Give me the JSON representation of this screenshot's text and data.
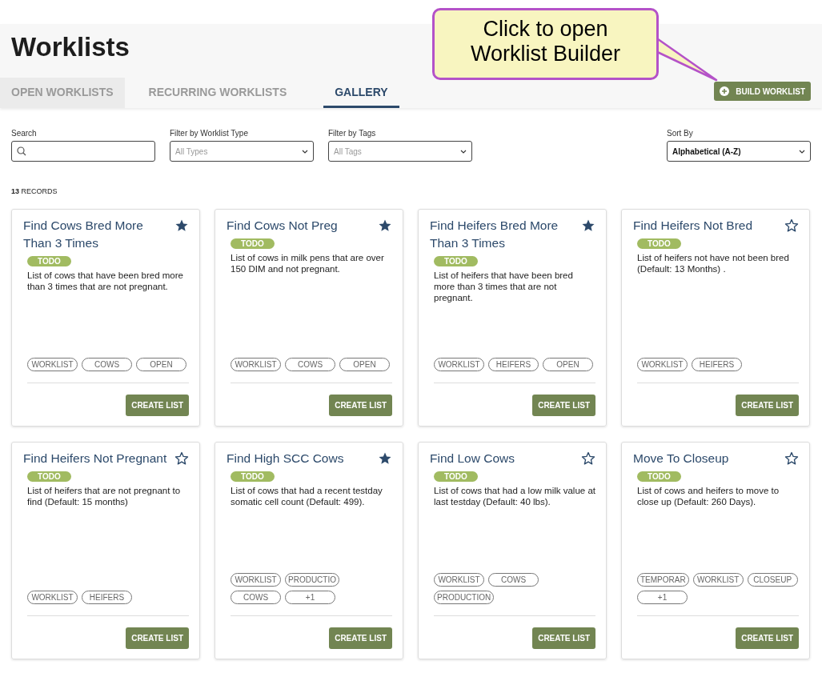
{
  "page": {
    "title": "Worklists"
  },
  "tabs": [
    {
      "label": "OPEN WORKLISTS",
      "selected": false,
      "hovered": true
    },
    {
      "label": "RECURRING WORKLISTS",
      "selected": false,
      "hovered": false
    },
    {
      "label": "GALLERY",
      "selected": true,
      "hovered": false
    }
  ],
  "build_button": {
    "label": "BUILD WORKLIST"
  },
  "callout": {
    "text": "Click to open Worklist Builder"
  },
  "filters": {
    "search": {
      "label": "Search"
    },
    "type": {
      "label": "Filter by Worklist Type",
      "value": "All Types"
    },
    "tags": {
      "label": "Filter by Tags",
      "value": "All Tags"
    },
    "sort": {
      "label": "Sort By",
      "value": "Alphabetical (A-Z)"
    }
  },
  "records": {
    "count": "13",
    "label": "RECORDS"
  },
  "cards": [
    {
      "title": "Find Cows Bred More Than 3 Times",
      "favorite": true,
      "status": "TODO",
      "description": "List of cows that have been bred more than 3 times that are not pregnant.",
      "tags": [
        "WORKLIST",
        "COWS",
        "OPEN"
      ],
      "button": "CREATE LIST"
    },
    {
      "title": "Find Cows Not Preg",
      "favorite": true,
      "status": "TODO",
      "description": "List of cows in milk pens that are over 150 DIM and not pregnant.",
      "tags": [
        "WORKLIST",
        "COWS",
        "OPEN"
      ],
      "button": "CREATE LIST"
    },
    {
      "title": "Find Heifers Bred More Than 3 Times",
      "favorite": true,
      "status": "TODO",
      "description": "List of heifers that have been bred more than 3 times that are not pregnant.",
      "tags": [
        "WORKLIST",
        "HEIFERS",
        "OPEN"
      ],
      "button": "CREATE LIST"
    },
    {
      "title": "Find Heifers Not Bred",
      "favorite": false,
      "status": "TODO",
      "description": "List of heifers not have not been bred (Default: 13 Months) .",
      "tags": [
        "WORKLIST",
        "HEIFERS"
      ],
      "button": "CREATE LIST"
    },
    {
      "title": "Find Heifers Not Pregnant",
      "favorite": false,
      "status": "TODO",
      "description": "List of heifers that are not pregnant to find (Default: 15 months)",
      "tags": [
        "WORKLIST",
        "HEIFERS"
      ],
      "button": "CREATE LIST"
    },
    {
      "title": "Find High SCC Cows",
      "favorite": true,
      "status": "TODO",
      "description": "List of cows that had a recent testday somatic cell count (Default: 499).",
      "tags": [
        "WORKLIST",
        "PRODUCTIO",
        "COWS",
        "+1"
      ],
      "button": "CREATE LIST"
    },
    {
      "title": "Find Low Cows",
      "favorite": false,
      "status": "TODO",
      "description": "List of cows that had a low milk value at last testday (Default: 40 lbs).",
      "tags": [
        "WORKLIST",
        "COWS",
        "PRODUCTION"
      ],
      "button": "CREATE LIST"
    },
    {
      "title": "Move To Closeup",
      "favorite": false,
      "status": "TODO",
      "description": "List of cows and heifers to move to close up (Default: 260 Days).",
      "tags": [
        "TEMPORAR",
        "WORKLIST",
        "CLOSEUP",
        "+1"
      ],
      "button": "CREATE LIST"
    }
  ]
}
